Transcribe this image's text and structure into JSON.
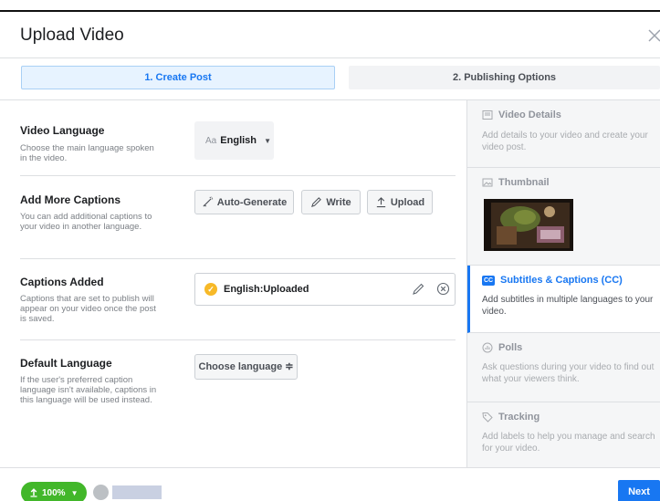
{
  "header": {
    "title": "Upload Video"
  },
  "steps": [
    {
      "label": "1. Create Post"
    },
    {
      "label": "2. Publishing Options"
    }
  ],
  "video_language": {
    "title": "Video Language",
    "description": "Choose the main language spoken in the video.",
    "prefix": "Aa",
    "value": "English"
  },
  "add_captions": {
    "title": "Add More Captions",
    "description": "You can add additional captions to your video in another language.",
    "buttons": [
      {
        "label": "Auto-Generate",
        "icon": "magic-wand-icon"
      },
      {
        "label": "Write",
        "icon": "pencil-icon"
      },
      {
        "label": "Upload",
        "icon": "upload-icon"
      }
    ]
  },
  "captions_added": {
    "title": "Captions Added",
    "description": "Captions that are set to publish will appear on your video once the post is saved.",
    "items": [
      {
        "label": "English:Uploaded"
      }
    ]
  },
  "default_language": {
    "title": "Default Language",
    "description": "If the user's preferred caption language isn't available, captions in this language will be used instead.",
    "button_label": "Choose language ≑"
  },
  "sidebar": {
    "items": [
      {
        "title": "Video Details",
        "description": "Add details to your video and create your video post.",
        "icon": "video-details-icon"
      },
      {
        "title": "Thumbnail",
        "description": "",
        "icon": "image-icon"
      },
      {
        "title": "Subtitles & Captions (CC)",
        "description": "Add subtitles in multiple languages to your video.",
        "icon": "cc-icon"
      },
      {
        "title": "Polls",
        "description": "Ask questions during your video to find out what your viewers think.",
        "icon": "poll-icon"
      },
      {
        "title": "Tracking",
        "description": "Add labels to help you manage and search for your video.",
        "icon": "tag-icon"
      }
    ]
  },
  "footer": {
    "progress_label": "100%",
    "progress_value": 100,
    "next_label": "Next"
  },
  "colors": {
    "accent": "#1877f2",
    "progress": "#42b72a",
    "caption_check": "#f7b928"
  }
}
